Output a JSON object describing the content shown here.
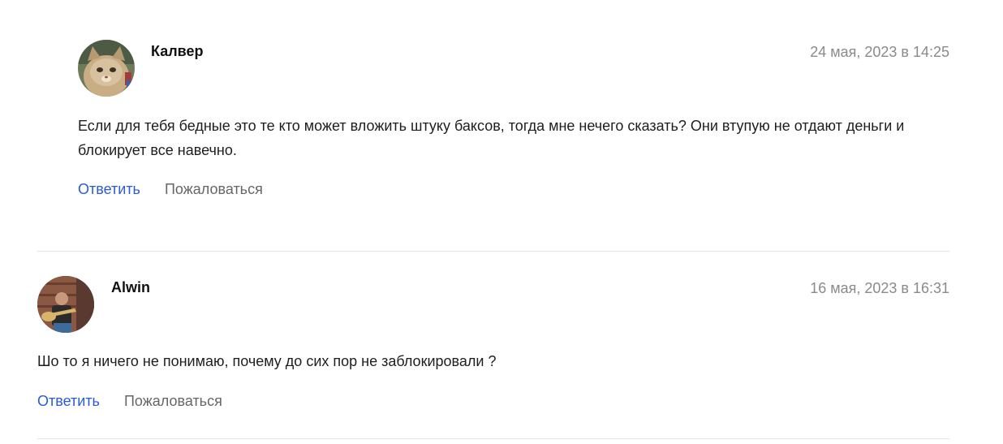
{
  "comments": [
    {
      "author": "Калвер",
      "date": "24 мая, 2023 в 14:25",
      "text": "Если для тебя бедные это те кто может вложить штуку баксов, тогда мне нечего сказать? Они втупую не отдают деньги и блокирует все навечно.",
      "reply_label": "Ответить",
      "report_label": "Пожаловаться"
    },
    {
      "author": "Alwin",
      "date": "16 мая, 2023 в 16:31",
      "text": "Шо то я ничего не понимаю, почему до сих пор не заблокировали ?",
      "reply_label": "Ответить",
      "report_label": "Пожаловаться"
    }
  ],
  "colors": {
    "reply_link": "#2a5bd7",
    "report_link": "#666666",
    "date": "#8a8a8a",
    "divider": "#e4e4e4"
  }
}
